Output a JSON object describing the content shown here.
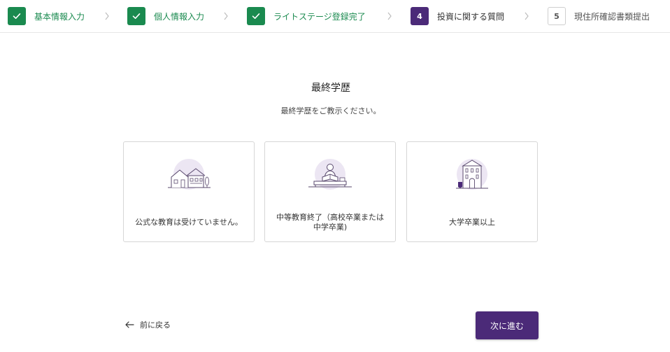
{
  "stepper": {
    "steps": [
      {
        "label": "基本情報入力",
        "status": "done",
        "number": ""
      },
      {
        "label": "個人情報入力",
        "status": "done",
        "number": ""
      },
      {
        "label": "ライトステージ登録完了",
        "status": "done",
        "number": ""
      },
      {
        "label": "投資に関する質問",
        "status": "current",
        "number": "4"
      },
      {
        "label": "現住所確認書類提出",
        "status": "todo",
        "number": "5"
      }
    ],
    "done_icon": "check-icon",
    "separator_icon": "chevron-right-icon"
  },
  "question": {
    "title": "最終学歴",
    "subtitle": "最終学歴をご教示ください。"
  },
  "options": [
    {
      "label": "公式な教育は受けていません。",
      "icon": "farmhouse-illustration-icon"
    },
    {
      "label": "中等教育終了（高校卒業または中学卒業)",
      "icon": "student-desk-illustration-icon"
    },
    {
      "label": "大学卒業以上",
      "icon": "university-building-illustration-icon"
    }
  ],
  "navigation": {
    "back_label": "前に戻る",
    "back_icon": "arrow-left-icon",
    "next_label": "次に進む"
  },
  "colors": {
    "done_green": "#1a8a4f",
    "brand_purple": "#4b2a78",
    "illustration_bg": "#ece6f3",
    "border": "#d6d6d6"
  }
}
